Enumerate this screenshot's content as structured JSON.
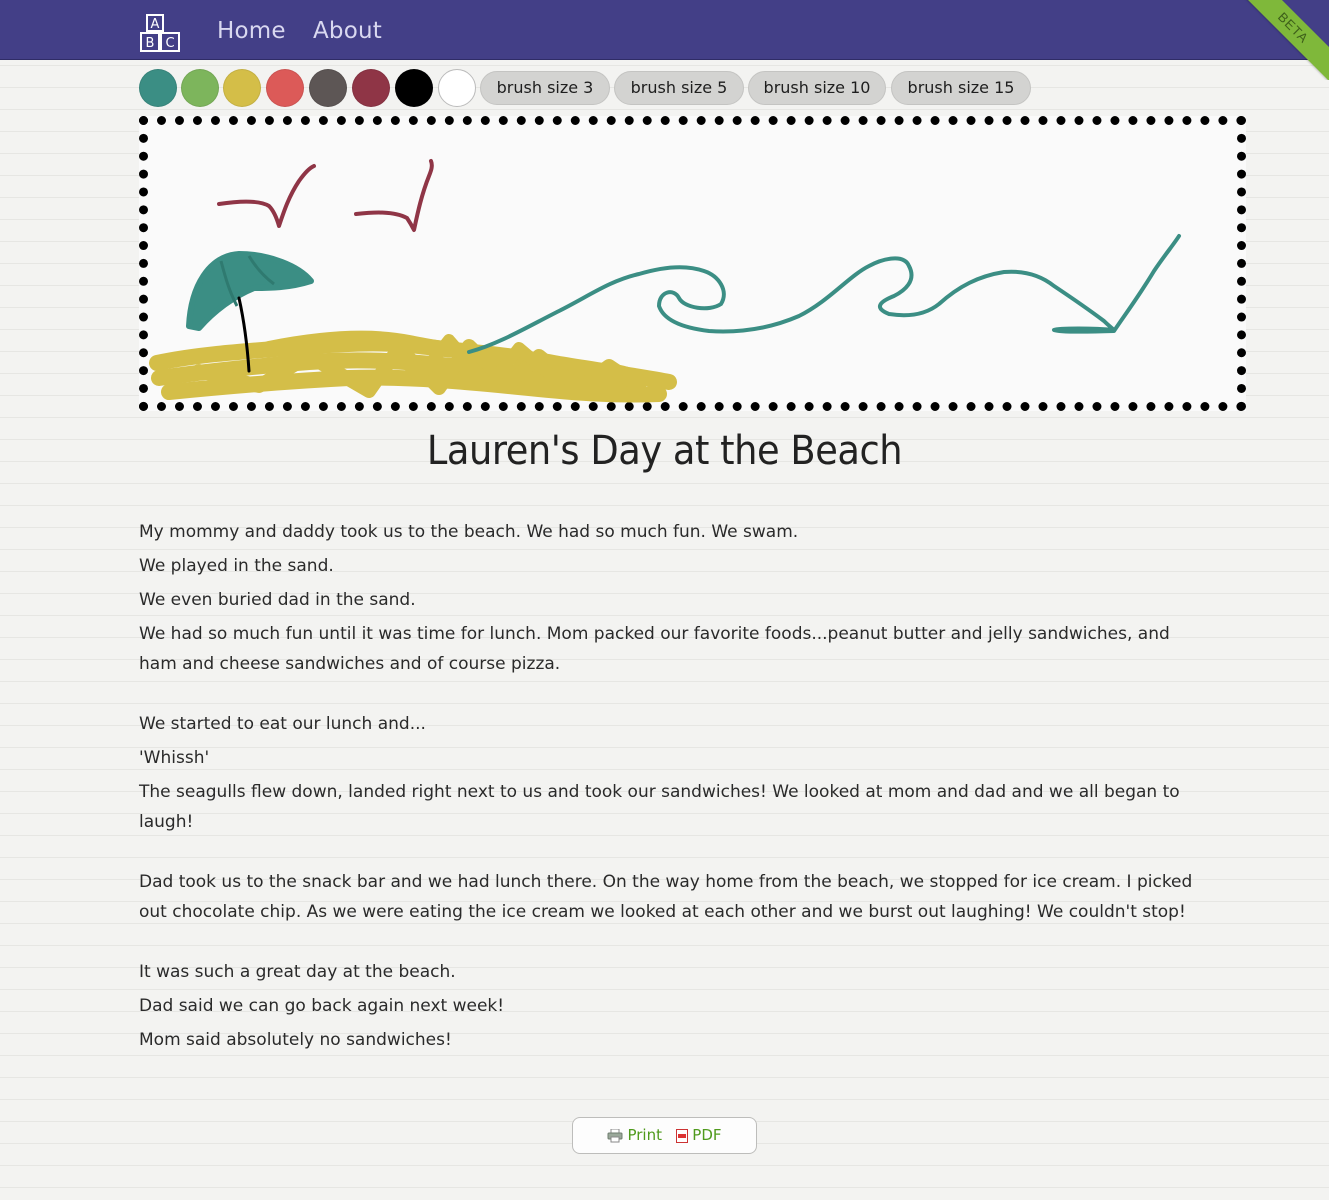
{
  "nav": {
    "home_label": "Home",
    "about_label": "About",
    "beta_label": "BETA",
    "logo_letters": [
      "A",
      "B",
      "C"
    ]
  },
  "toolbar": {
    "colors": [
      "#3b8e84",
      "#7db55c",
      "#d4be48",
      "#dc5a58",
      "#5d5655",
      "#8f3546",
      "#000000",
      "#ffffff"
    ],
    "brush_sizes": [
      "brush size 3",
      "brush size 5",
      "brush size 10",
      "brush size 15"
    ]
  },
  "story": {
    "title": "Lauren's Day at the Beach",
    "paragraphs": [
      "My mommy and daddy took us to the beach. We had so much fun. We swam.",
      "We played in the sand.",
      "We even buried dad in the sand.",
      "We had so much fun until it was time for lunch. Mom packed our favorite foods...peanut butter and jelly sandwiches, and ham and cheese sandwiches and of course pizza.",
      "We started to eat our lunch and...",
      "'Whissh'",
      "The seagulls flew down, landed right next to us and took our sandwiches! We looked at mom and dad and we all began to laugh!",
      "Dad took us to the snack bar and we had lunch there. On the way home from the beach, we stopped for ice cream. I picked out chocolate chip. As we were eating the ice cream we looked at each other and we burst out laughing! We couldn't stop!",
      "It was such a great day at the beach.",
      "Dad said we can go back again next week!",
      "Mom said absolutely no sandwiches!"
    ]
  },
  "export": {
    "print_label": "Print",
    "pdf_label": "PDF",
    "print_icon": "printer-icon",
    "pdf_icon": "pdf-icon"
  }
}
